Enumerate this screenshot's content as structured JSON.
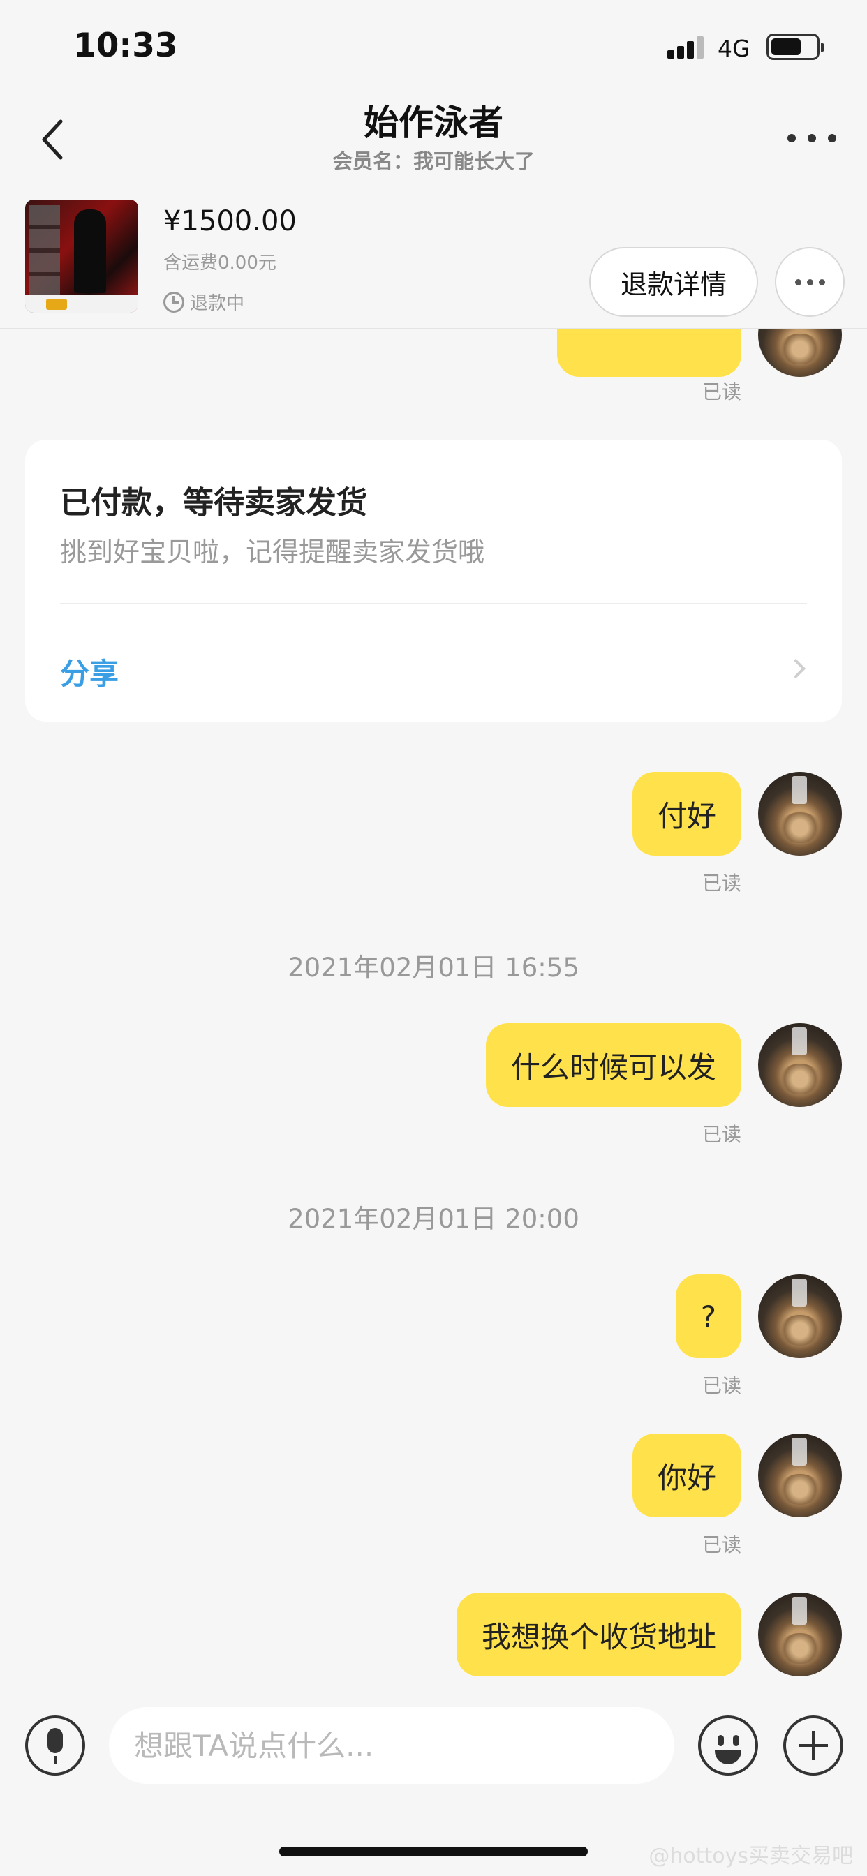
{
  "status_bar": {
    "time": "10:33",
    "network": "4G"
  },
  "header": {
    "title": "始作泳者",
    "member_label": "会员名：",
    "member_name": "我可能长大了"
  },
  "order": {
    "price": "¥1500.00",
    "shipping": "含运费0.00元",
    "status": "退款中",
    "refund_button": "退款详情"
  },
  "chat": {
    "read_label": "已读",
    "system_card": {
      "title": "已付款，等待卖家发货",
      "subtitle": "挑到好宝贝啦，记得提醒卖家发货哦",
      "share": "分享"
    },
    "items": [
      {
        "type": "message",
        "text": "付好"
      },
      {
        "type": "timestamp",
        "text": "2021年02月01日  16:55"
      },
      {
        "type": "message",
        "text": "什么时候可以发"
      },
      {
        "type": "timestamp",
        "text": "2021年02月01日  20:00"
      },
      {
        "type": "message",
        "text": "?"
      },
      {
        "type": "message",
        "text": "你好"
      },
      {
        "type": "message",
        "text": "我想换个收货地址"
      }
    ]
  },
  "input": {
    "placeholder": "想跟TA说点什么..."
  },
  "watermark": "@hottoys买卖交易吧",
  "colors": {
    "bubble": "#ffe24b",
    "link": "#3a9ee4",
    "background": "#f6f6f6"
  }
}
